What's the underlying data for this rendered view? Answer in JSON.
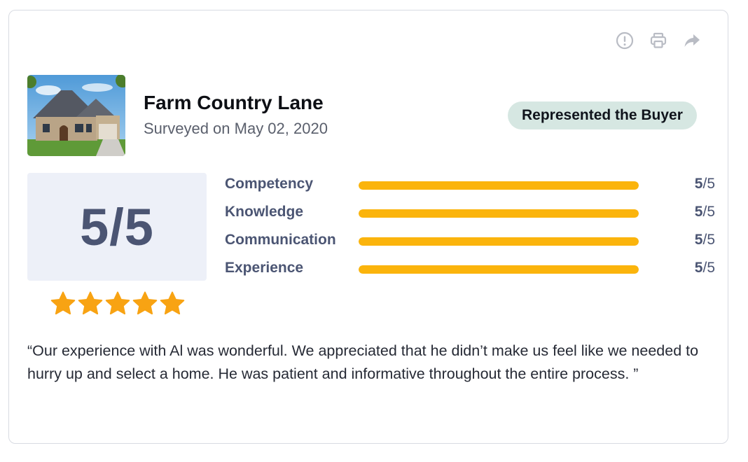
{
  "header": {
    "title": "Farm Country Lane",
    "subtitle": "Surveyed on May 02, 2020",
    "badge": "Represented the Buyer"
  },
  "toolbar": {
    "icons": [
      "report-icon",
      "print-icon",
      "share-icon"
    ]
  },
  "score": {
    "overall": "5/5",
    "stars": 5
  },
  "ratings": [
    {
      "label": "Competency",
      "score": "5",
      "max": "/5",
      "fraction": 1.0
    },
    {
      "label": "Knowledge",
      "score": "5",
      "max": "/5",
      "fraction": 1.0
    },
    {
      "label": "Communication",
      "score": "5",
      "max": "/5",
      "fraction": 1.0
    },
    {
      "label": "Experience",
      "score": "5",
      "max": "/5",
      "fraction": 1.0
    }
  ],
  "review": {
    "text": "“Our experience with Al was wonderful. We appreciated that he didn’t make us feel like we needed to hurry up and select a home. He was patient and informative throughout the entire process. ”"
  },
  "colors": {
    "bar": "#fbb40c",
    "star": "#f8a313",
    "badge_bg": "#d6e7e2",
    "score_bg": "#edf0f8",
    "label": "#4b5573"
  }
}
